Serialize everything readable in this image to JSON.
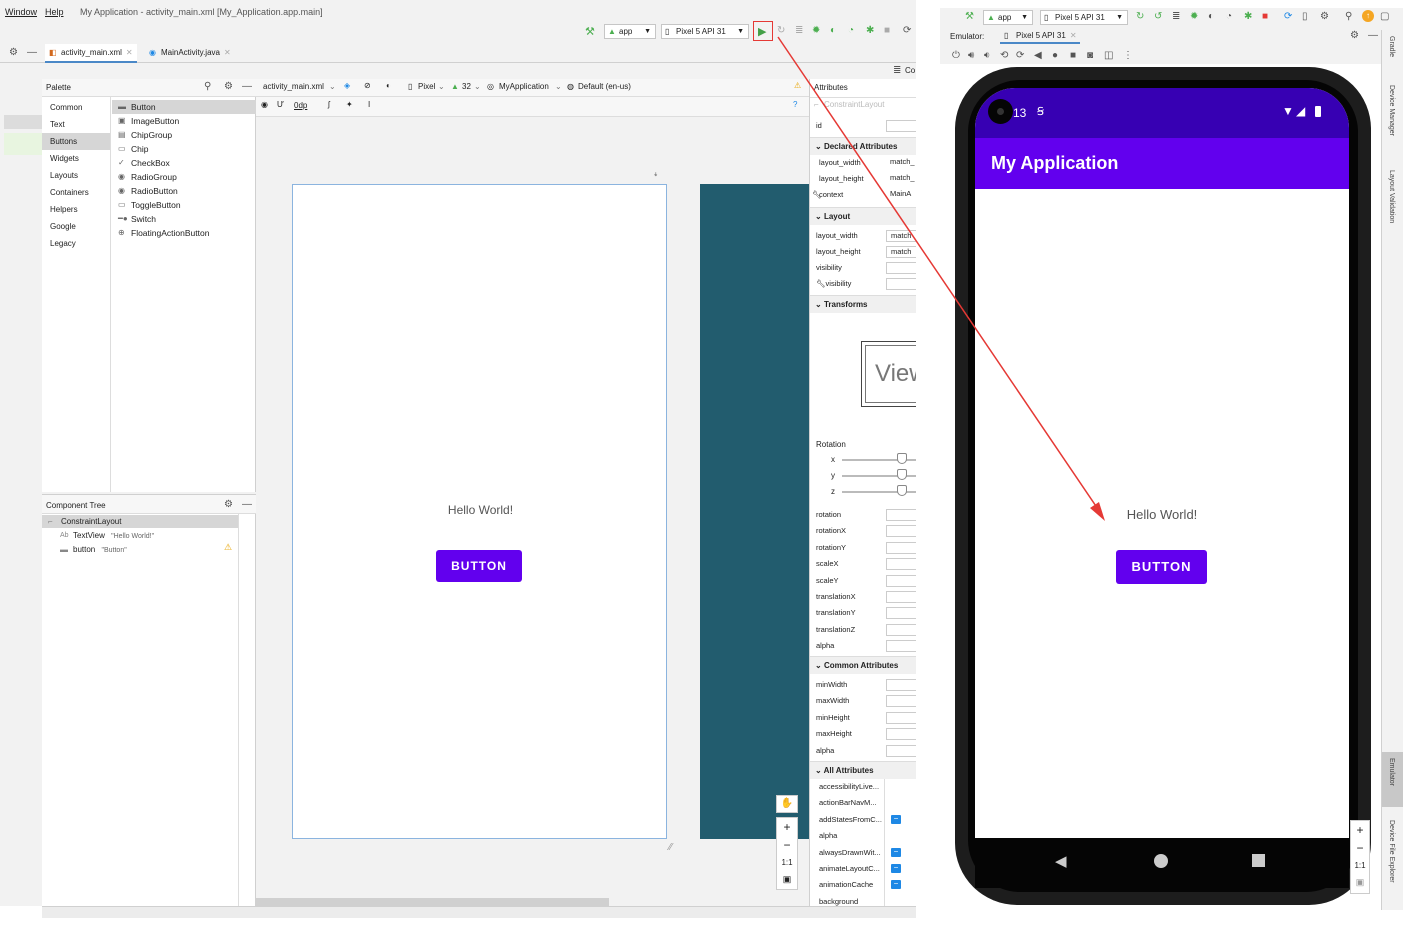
{
  "menu": {
    "window": "Window",
    "help": "Help",
    "title": "My Application - activity_main.xml [My_Application.app.main]"
  },
  "toolbar": {
    "config": "app",
    "device": "Pixel 5 API 31"
  },
  "tabs": [
    {
      "label": "activity_main.xml"
    },
    {
      "label": "MainActivity.java"
    }
  ],
  "palette": {
    "title": "Palette",
    "categories": [
      "Common",
      "Text",
      "Buttons",
      "Widgets",
      "Layouts",
      "Containers",
      "Helpers",
      "Google",
      "Legacy"
    ],
    "items": [
      "Button",
      "ImageButton",
      "ChipGroup",
      "Chip",
      "CheckBox",
      "RadioGroup",
      "RadioButton",
      "ToggleButton",
      "Switch",
      "FloatingActionButton"
    ]
  },
  "design_toolbar": {
    "file": "activity_main.xml",
    "device": "Pixel",
    "api": "32",
    "theme": "MyApplication",
    "locale": "Default (en-us)",
    "margin": "0dp"
  },
  "component_tree": {
    "title": "Component Tree",
    "root": "ConstraintLayout",
    "textview_label": "TextView",
    "textview_text": "\"Hello World!\"",
    "button_label": "button",
    "button_text": "\"Button\""
  },
  "preview": {
    "hello": "Hello World!",
    "button": "BUTTON"
  },
  "attributes": {
    "title": "Attributes",
    "type": "ConstraintLayout",
    "id": "id",
    "declared": "Declared Attributes",
    "declared_rows": [
      {
        "name": "layout_width",
        "value": "match_"
      },
      {
        "name": "layout_height",
        "value": "match_"
      },
      {
        "name": "context",
        "value": "MainA"
      }
    ],
    "layout": "Layout",
    "layout_rows": [
      {
        "name": "layout_width",
        "value": "match"
      },
      {
        "name": "layout_height",
        "value": "match"
      },
      {
        "name": "visibility",
        "value": ""
      },
      {
        "name": "visibility",
        "value": ""
      }
    ],
    "transforms": "Transforms",
    "view_preview": "View",
    "rotation": "Rotation",
    "axes": [
      "x",
      "y",
      "z"
    ],
    "transform_rows": [
      "rotation",
      "rotationX",
      "rotationY",
      "scaleX",
      "scaleY",
      "translationX",
      "translationY",
      "translationZ",
      "alpha"
    ],
    "common": "Common Attributes",
    "common_rows": [
      "minWidth",
      "maxWidth",
      "minHeight",
      "maxHeight",
      "alpha"
    ],
    "all": "All Attributes",
    "all_rows": [
      "accessibilityLive...",
      "actionBarNavM...",
      "addStatesFromC...",
      "alpha",
      "alwaysDrawnWit...",
      "animateLayoutC...",
      "animationCache",
      "background"
    ],
    "right_toolbar_label": "Co"
  },
  "emulator": {
    "label": "Emulator:",
    "tab": "Pixel 5 API 31",
    "config": "app",
    "device": "Pixel 5 API 31",
    "status_time": "13",
    "app_title": "My Application",
    "hello": "Hello World!",
    "button": "BUTTON",
    "zoom_ratio": "1:1",
    "side_tabs": [
      "Gradle",
      "Device Manager",
      "Layout Validation",
      "Emulator",
      "Device File Explorer"
    ]
  },
  "colors": {
    "primary": "#6200ee",
    "primary_dark": "#3700b3",
    "blueprint": "#225c6e",
    "highlight": "#e53935"
  }
}
